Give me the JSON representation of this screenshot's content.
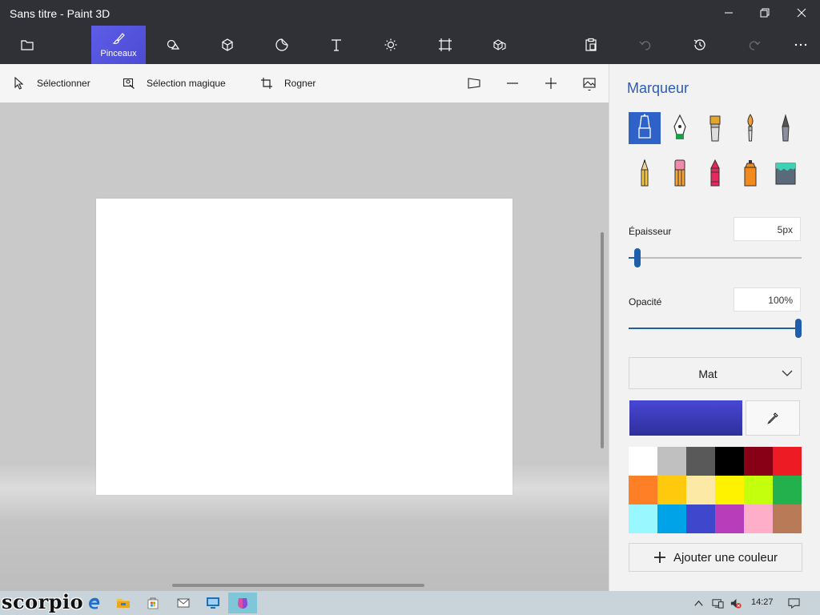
{
  "window": {
    "title": "Sans titre - Paint 3D",
    "controls": [
      "minimize-icon",
      "restore-icon",
      "close-icon"
    ]
  },
  "toolbar": {
    "active_tool_label": "Pinceaux",
    "tools": [
      "folder-icon",
      "brushes-icon",
      "2d-shapes-icon",
      "3d-shapes-icon",
      "stickers-icon",
      "text-icon",
      "effects-icon",
      "canvas-icon",
      "3d-library-icon",
      "paste-icon",
      "undo-icon",
      "history-icon",
      "redo-icon",
      "more-icon"
    ]
  },
  "subtoolbar": {
    "select": "Sélectionner",
    "magic_select": "Sélection magique",
    "crop": "Rogner"
  },
  "panel": {
    "title": "Marqueur",
    "brushes": [
      "marker",
      "calligraphy-pen",
      "oil-brush",
      "watercolor",
      "pixel-pen",
      "pencil",
      "eraser",
      "crayon",
      "spray-can",
      "fill"
    ],
    "selected_brush": "marker",
    "thickness": {
      "label": "Épaisseur",
      "value": "5px",
      "level": 0.05
    },
    "opacity": {
      "label": "Opacité",
      "value": "100%",
      "level": 1.0
    },
    "finish": "Mat",
    "current_color": "#4747d6",
    "add_color": "Ajouter une couleur"
  },
  "palette": [
    "#ffffff",
    "#c0c0c0",
    "#595959",
    "#000000",
    "#880015",
    "#ed1c24",
    "#ff7f27",
    "#ffc90e",
    "#fde9a6",
    "#fff200",
    "#c4ff0e",
    "#22b14c",
    "#99f8ff",
    "#00a2e8",
    "#3f48cc",
    "#b83dba",
    "#ffaec9",
    "#b97a57"
  ],
  "taskbar": {
    "watermark": "scorpio",
    "apps": [
      "edge-icon",
      "file-explorer-icon",
      "store-icon",
      "mail-icon",
      "remote-desktop-icon",
      "paint-3d-icon"
    ],
    "clock": "14:27"
  }
}
